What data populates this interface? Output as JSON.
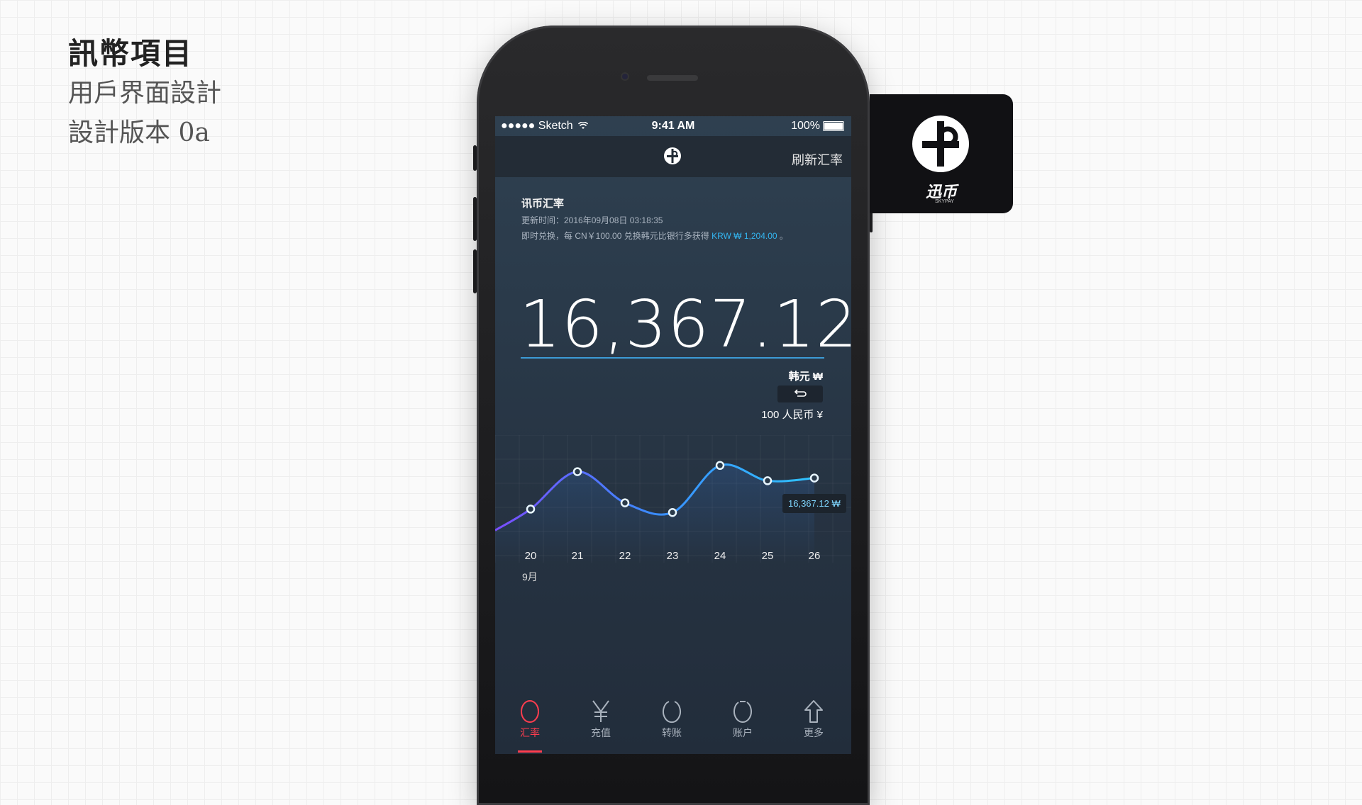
{
  "headline": {
    "title": "訊幣項目",
    "line1": "用戶界面設計",
    "line2": "設計版本 0a"
  },
  "status_bar": {
    "carrier": "●●●●● Sketch",
    "time": "9:41 AM",
    "battery": "100%"
  },
  "nav": {
    "logo_icon": "skypay-logo-icon",
    "refresh_label": "刷新汇率"
  },
  "info": {
    "title": "讯币汇率",
    "update_time": "更新时间：2016年09月08日 03:18:35",
    "promo_prefix": "即时兑换，每 CN￥100.00 兑换韩元比银行多获得",
    "promo_highlight": "KRW ₩ 1,204.00",
    "promo_suffix": "。"
  },
  "converter": {
    "amount": "16,367.12",
    "to_currency": "韩元 ₩",
    "swap_icon": "swap-icon",
    "from_currency": "100 人民币 ¥"
  },
  "chart_data": {
    "type": "line",
    "x": [
      "20",
      "21",
      "22",
      "23",
      "24",
      "25",
      "26"
    ],
    "series": [
      {
        "values": [
          15820,
          16480,
          15930,
          15760,
          16590,
          16320,
          16367.12
        ]
      }
    ],
    "tooltip": "16,367.12 ₩",
    "xlabel": "9月",
    "ylim": [
      15000,
      17000
    ],
    "grid": true
  },
  "tabs": [
    {
      "label": "汇率",
      "icon": "circle-icon",
      "active": true
    },
    {
      "label": "充值",
      "icon": "yen-icon",
      "active": false
    },
    {
      "label": "转账",
      "icon": "transfer-icon",
      "active": false
    },
    {
      "label": "账户",
      "icon": "account-icon",
      "active": false
    },
    {
      "label": "更多",
      "icon": "arrow-up-icon",
      "active": false
    }
  ],
  "brand_card": {
    "name": "迅币",
    "sub": "SKYPAY"
  },
  "colors": {
    "accent": "#33b5f0",
    "active_tab": "#ff3d4f",
    "screen_bg": "#2a3a4a"
  }
}
